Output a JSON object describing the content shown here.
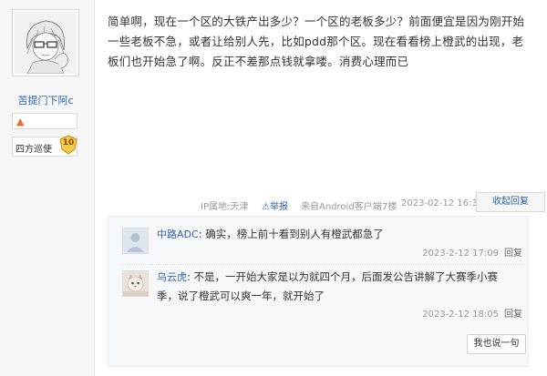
{
  "user": {
    "username": "苦提门下阿c",
    "title": "四方巡使",
    "level": "10",
    "badge_icon": "fire-flame-icon"
  },
  "post": {
    "content": "简单啊，现在一个区的大铁产出多少？一个区的老板多少？前面便宜是因为刚开始一些老板不急，或者让给别人先，比如pdd那个区。现在看看榜上橙武的出现，老板们也开始急了啊。反正不差那点钱就拿喽。消费心理而已",
    "ip_location": "IP属地:天津",
    "report_label": "举报",
    "source": "来自Android客户端",
    "floor": "7楼",
    "time": "2023-02-12 16:32",
    "collapse_reply_label": "收起回复"
  },
  "sub_replies": [
    {
      "author": "中路ADC",
      "separator": ": ",
      "text": "确实，榜上前十看到别人有橙武都急了",
      "time": "2023-2-12 17:09",
      "reply_label": "回复"
    },
    {
      "author": "乌云虎",
      "separator": ": ",
      "text": "不是，一开始大家是以为就四个月，后面发公告讲解了大赛季小赛季，说了橙武可以爽一年，就开始了",
      "time": "2023-2-12 18:05",
      "reply_label": "回复"
    }
  ],
  "say_button_label": "我也说一句",
  "colors": {
    "link": "#2d64b3",
    "meta": "#999999",
    "text": "#333333"
  }
}
